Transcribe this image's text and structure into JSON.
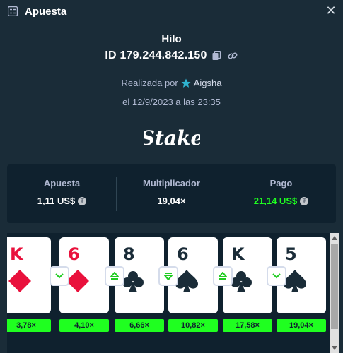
{
  "header": {
    "title": "Apuesta"
  },
  "bet": {
    "game": "Hilo",
    "id": "ID 179.244.842.150",
    "placed_by_prefix": "Realizada por",
    "user": "Aigsha",
    "date": "el 12/9/2023 a las 23:35"
  },
  "logo": {
    "text": "Stake"
  },
  "stats": {
    "bet_label": "Apuesta",
    "bet_value": "1,11 US$",
    "multiplier_label": "Multiplicador",
    "multiplier_value": "19,04×",
    "payout_label": "Pago",
    "payout_value": "21,14 US$"
  },
  "cards": [
    {
      "rank": "K",
      "suit": "diamond",
      "color": "red",
      "multiplier": "3,78×"
    },
    {
      "rank": "6",
      "suit": "diamond",
      "color": "red",
      "multiplier": "4,10×",
      "arrow_before": "down"
    },
    {
      "rank": "8",
      "suit": "club",
      "color": "black",
      "multiplier": "6,66×",
      "arrow_before": "up"
    },
    {
      "rank": "6",
      "suit": "spade",
      "color": "black",
      "multiplier": "10,82×",
      "arrow_before": "down-equal"
    },
    {
      "rank": "K",
      "suit": "club",
      "color": "black",
      "multiplier": "17,58×",
      "arrow_before": "up"
    },
    {
      "rank": "5",
      "suit": "spade",
      "color": "black",
      "multiplier": "19,04×",
      "arrow_before": "down"
    }
  ],
  "colors": {
    "background": "#1a2c38",
    "panel": "#0f212e",
    "accent_green": "#1fff20",
    "red_suit": "#e9113c",
    "muted_text": "#b1bad3"
  },
  "icons": {
    "header": "bet-slip-icon",
    "close": "close-icon",
    "copy": "copy-icon",
    "link": "link-icon",
    "vip": "star-icon",
    "coin": "coin-icon"
  }
}
